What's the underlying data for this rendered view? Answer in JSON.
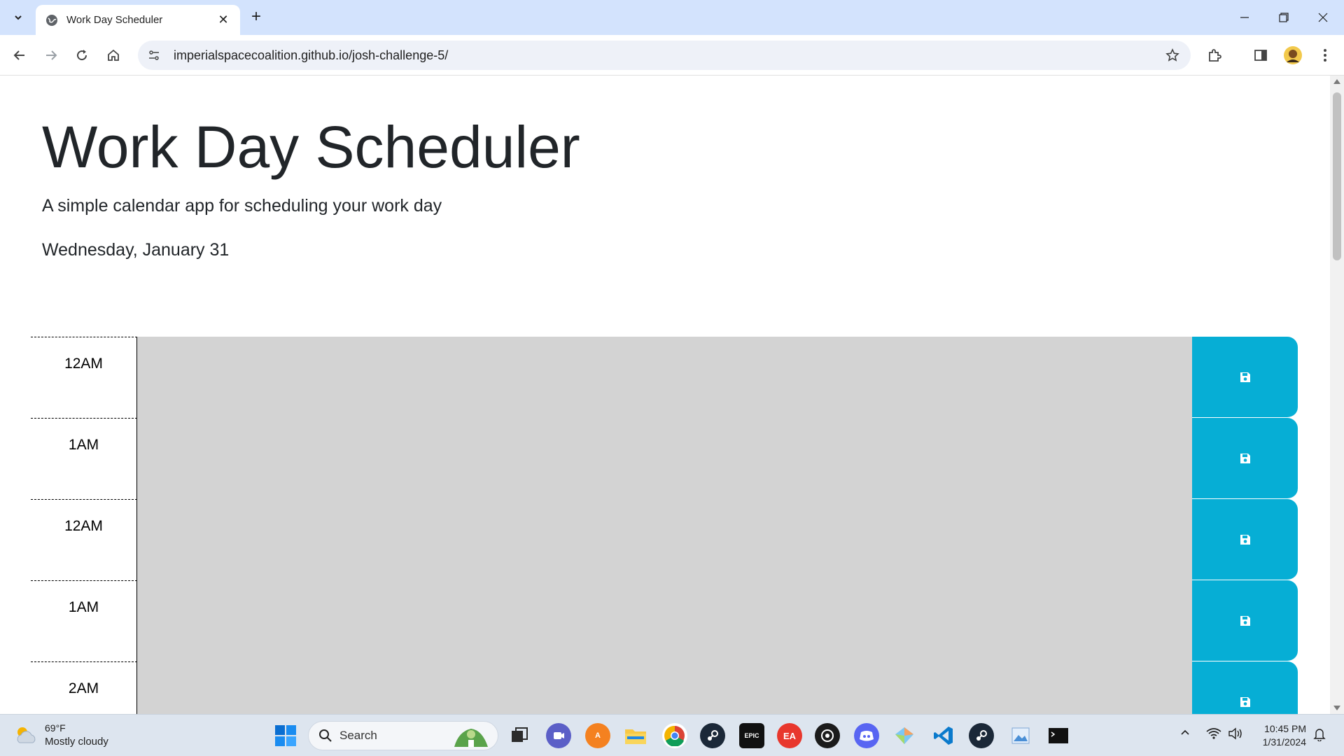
{
  "browser": {
    "tab_title": "Work Day Scheduler",
    "url": "imperialspacecoalition.github.io/josh-challenge-5/"
  },
  "page": {
    "title": "Work Day Scheduler",
    "lead": "A simple calendar app for scheduling your work day",
    "current_day": "Wednesday, January 31"
  },
  "time_blocks": [
    {
      "hour": "12AM",
      "text": ""
    },
    {
      "hour": "1AM",
      "text": ""
    },
    {
      "hour": "12AM",
      "text": ""
    },
    {
      "hour": "1AM",
      "text": ""
    },
    {
      "hour": "2AM",
      "text": ""
    }
  ],
  "taskbar": {
    "weather_temp": "69°F",
    "weather_condition": "Mostly cloudy",
    "search_label": "Search",
    "time": "10:45 PM",
    "date": "1/31/2024"
  },
  "colors": {
    "past_block": "#d3d3d3",
    "save_button": "#06aed5"
  }
}
